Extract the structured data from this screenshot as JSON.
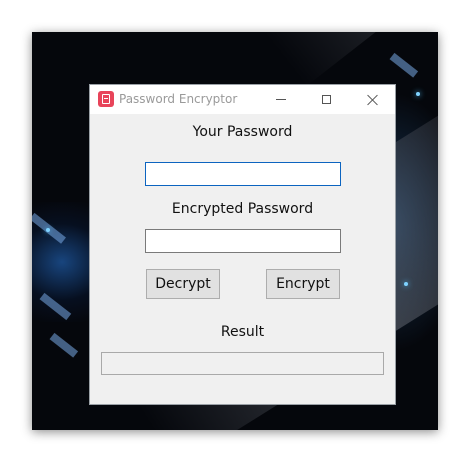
{
  "window": {
    "title": "Password Encryptor",
    "controls": {
      "minimize": "minimize",
      "maximize": "maximize",
      "close": "close"
    }
  },
  "form": {
    "password_label": "Your Password",
    "password_value": "",
    "encrypted_label": "Encrypted Password",
    "encrypted_value": "",
    "decrypt_button": "Decrypt",
    "encrypt_button": "Encrypt",
    "result_label": "Result",
    "result_value": ""
  },
  "colors": {
    "accent_focus": "#0c64c0",
    "app_icon": "#e8445a",
    "window_bg": "#f0f0f0"
  },
  "icons": {
    "app": "app-icon",
    "minimize": "minimize-icon",
    "maximize": "maximize-icon",
    "close": "close-icon"
  }
}
